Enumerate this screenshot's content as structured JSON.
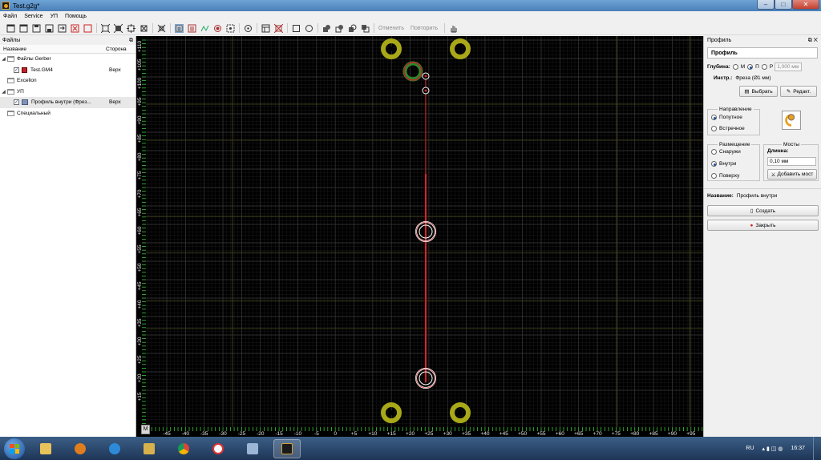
{
  "window": {
    "title": "Test.g2g*"
  },
  "menu": [
    "Файл",
    "Service",
    "УП",
    "Помощь"
  ],
  "toolbar": {
    "undo_label": "Отменить",
    "redo_label": "Повторить"
  },
  "left_panel": {
    "title": "Файлы",
    "col_name": "Название",
    "col_side": "Сторона",
    "tree": [
      {
        "label": "Файлы Gerber",
        "side": ""
      },
      {
        "label": "Test.GM4",
        "side": "Верх"
      },
      {
        "label": "Excellon",
        "side": ""
      },
      {
        "label": "УП",
        "side": ""
      },
      {
        "label": "Профиль внутри (Фрез...",
        "side": "Верх"
      },
      {
        "label": "Специальный",
        "side": ""
      }
    ]
  },
  "canvas": {
    "x_ticks": [
      "-45",
      "-40",
      "-35",
      "-30",
      "-25",
      "-20",
      "-15",
      "-10",
      "-5",
      "0",
      "+5",
      "+10",
      "+15",
      "+20",
      "+25",
      "+30",
      "+35",
      "+40",
      "+45",
      "+50",
      "+55",
      "+60",
      "+65",
      "+70",
      "+75",
      "+80",
      "+85",
      "+90",
      "+95"
    ],
    "y_ticks": [
      "+110",
      "+105",
      "+100",
      "+95",
      "+90",
      "+85",
      "+80",
      "+75",
      "+70",
      "+65",
      "+60",
      "+55",
      "+50",
      "+45",
      "+40",
      "+35",
      "+30",
      "+25",
      "+20",
      "+15"
    ],
    "corner_button": "M"
  },
  "right_panel": {
    "title": "Профиль",
    "box_title": "Профиль",
    "depth_label": "Глубина:",
    "depth_options": [
      "М",
      "П",
      "Р"
    ],
    "depth_value": "1,000 мм",
    "tool_label": "Инстр.:",
    "tool_value": "Фреза (Ø1 мм)",
    "select_button": "Выбрать",
    "edit_button": "Редакт.",
    "direction": {
      "legend": "Направление",
      "options": [
        "Попутное",
        "Встречное"
      ]
    },
    "placement": {
      "legend": "Размещение",
      "options": [
        "Снаружи",
        "Внутри",
        "Поверху"
      ]
    },
    "bridges": {
      "legend": "Мосты",
      "length_label": "Длинна:",
      "length_value": "0,10 мм",
      "add_button": "Добавить мост"
    },
    "name_label": "Название:",
    "name_value": "Профиль внутри",
    "create_button": "Создать",
    "close_button": "Закрыть"
  },
  "taskbar": {
    "lang": "RU",
    "time": "16:37"
  },
  "colors": {
    "accent": "#1b4d9a",
    "profile_line": "#e0202a",
    "pad": "#b8b81e"
  }
}
